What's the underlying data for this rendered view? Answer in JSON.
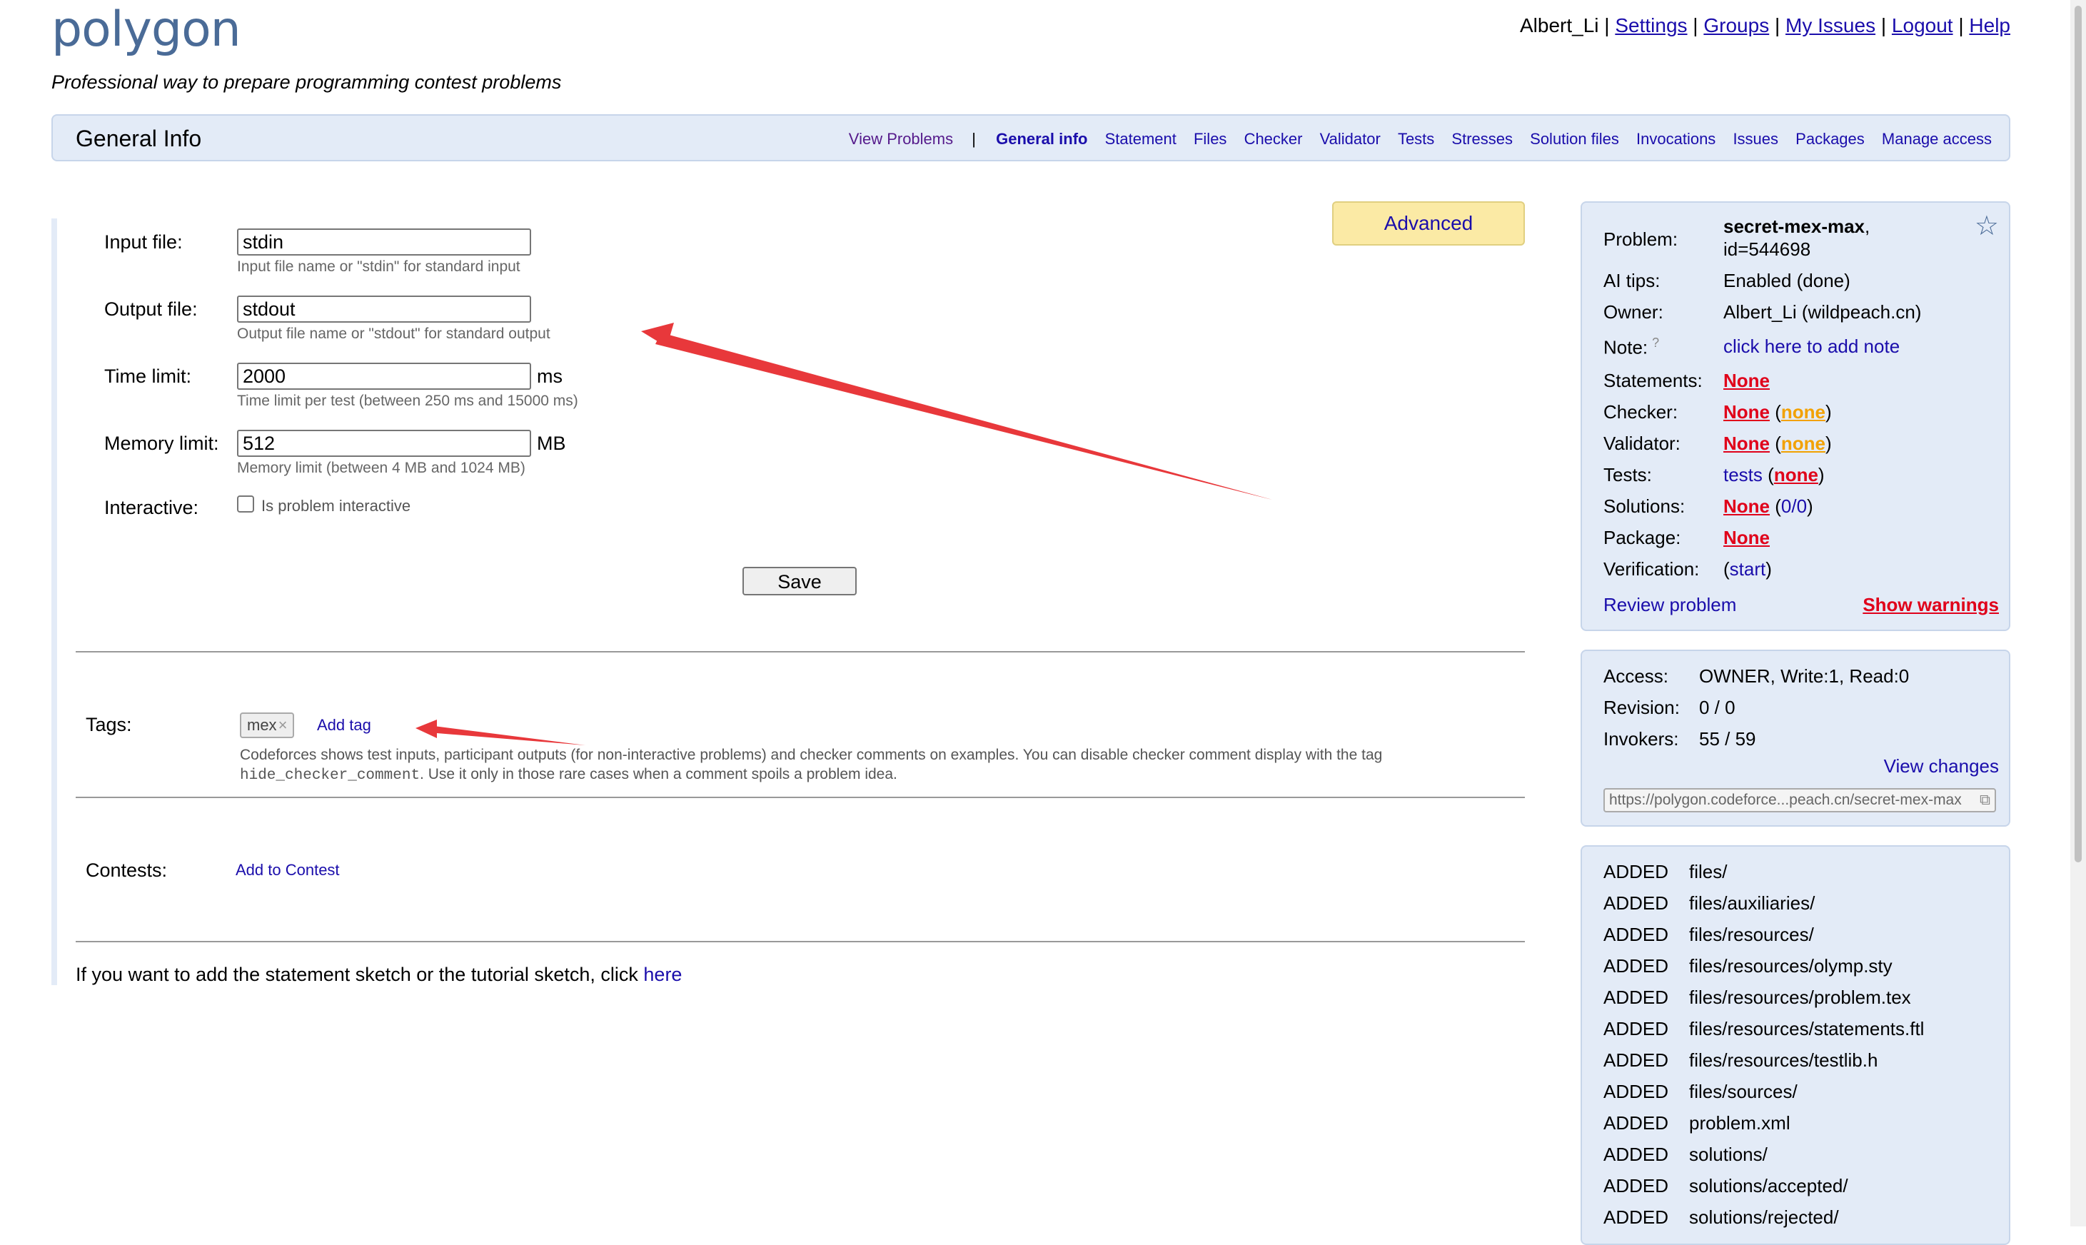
{
  "header": {
    "logo": "polygon",
    "tagline": "Professional way to prepare programming contest problems",
    "user": "Albert_Li",
    "links": [
      "Settings",
      "Groups",
      "My Issues",
      "Logout",
      "Help"
    ]
  },
  "titlebar": {
    "title": "General Info",
    "view_problems": "View Problems",
    "sep": "|",
    "tabs": [
      "General info",
      "Statement",
      "Files",
      "Checker",
      "Validator",
      "Tests",
      "Stresses",
      "Solution files",
      "Invocations",
      "Issues",
      "Packages",
      "Manage access"
    ]
  },
  "form": {
    "advanced": "Advanced",
    "input_file": {
      "label": "Input file:",
      "value": "stdin",
      "hint": "Input file name or \"stdin\" for standard input"
    },
    "output_file": {
      "label": "Output file:",
      "value": "stdout",
      "hint": "Output file name or \"stdout\" for standard output"
    },
    "time_limit": {
      "label": "Time limit:",
      "value": "2000",
      "unit": "ms",
      "hint": "Time limit per test (between 250 ms and 15000 ms)"
    },
    "memory_limit": {
      "label": "Memory limit:",
      "value": "512",
      "unit": "MB",
      "hint": "Memory limit (between 4 MB and 1024 MB)"
    },
    "interactive": {
      "label": "Interactive:",
      "checkbox_label": "Is problem interactive"
    },
    "save": "Save"
  },
  "tags": {
    "label": "Tags:",
    "items": [
      "mex"
    ],
    "remove_glyph": "×",
    "add_tag": "Add tag",
    "note_pre": "Codeforces shows test inputs, participant outputs (for non-interactive problems) and checker comments on examples. You can disable checker comment display with the tag",
    "note_code": "hide_checker_comment",
    "note_post": ". Use it only in those rare cases when a comment spoils a problem idea."
  },
  "contests": {
    "label": "Contests:",
    "add": "Add to Contest"
  },
  "sketch": {
    "text": "If you want to add the statement sketch or the tutorial sketch, click ",
    "link": "here"
  },
  "problem_panel": {
    "problem_label": "Problem:",
    "problem_name": "secret-mex-max",
    "problem_comma": ",",
    "problem_id": "id=544698",
    "ai_label": "AI tips:",
    "ai_value": "Enabled (done)",
    "owner_label": "Owner:",
    "owner_value": "Albert_Li (wildpeach.cn)",
    "note_label": "Note:",
    "note_help": "?",
    "note_value": "click here to add note",
    "statements_label": "Statements:",
    "statements_value": "None",
    "checker_label": "Checker:",
    "checker_value": "None",
    "checker_sub": "none",
    "validator_label": "Validator:",
    "validator_value": "None",
    "validator_sub": "none",
    "tests_label": "Tests:",
    "tests_value": "tests",
    "tests_sub": "none",
    "solutions_label": "Solutions:",
    "solutions_value": "None",
    "solutions_sub": "0/0",
    "package_label": "Package:",
    "package_value": "None",
    "verification_label": "Verification:",
    "verification_value": "start",
    "review": "Review problem",
    "warnings": "Show warnings"
  },
  "access_panel": {
    "access_label": "Access:",
    "access_value": "OWNER, Write:1, Read:0",
    "revision_label": "Revision:",
    "revision_value": "0 / 0",
    "invokers_label": "Invokers:",
    "invokers_value": "55 / 59",
    "view_changes": "View changes",
    "url": "https://polygon.codeforce...peach.cn/secret-mex-max"
  },
  "changes_panel": {
    "status": "ADDED",
    "items": [
      "files/",
      "files/auxiliaries/",
      "files/resources/",
      "files/resources/olymp.sty",
      "files/resources/problem.tex",
      "files/resources/statements.ftl",
      "files/resources/testlib.h",
      "files/sources/",
      "problem.xml",
      "solutions/",
      "solutions/accepted/",
      "solutions/rejected/"
    ]
  },
  "colors": {
    "accent_red": "#e0001a",
    "accent_orange": "#f2a100",
    "panel_bg": "#e3ebf7",
    "annotation_arrow": "#e8383b"
  }
}
